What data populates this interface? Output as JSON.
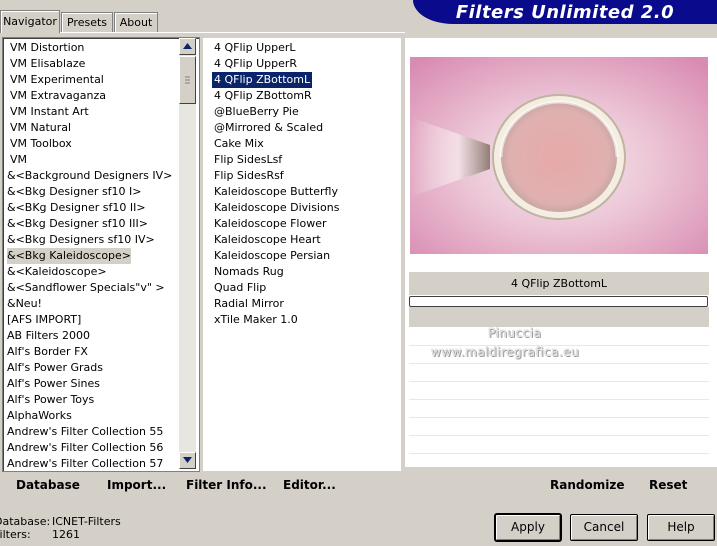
{
  "tabs": [
    "Navigator",
    "Presets",
    "About"
  ],
  "banner_title": "Filters Unlimited 2.0",
  "categories": [
    "VM Distortion",
    "VM Elisablaze",
    "VM Experimental",
    "VM Extravaganza",
    "VM Instant Art",
    "VM Natural",
    "VM Toolbox",
    "VM",
    "&<Background Designers IV>",
    "&<Bkg Designer sf10 I>",
    "&<BKg Designer sf10 II>",
    "&<Bkg Designer sf10 III>",
    "&<Bkg Designers sf10 IV>",
    "&<Bkg Kaleidoscope>",
    "&<Kaleidoscope>",
    "&<Sandflower Specials\"v\" >",
    "&Neu!",
    "[AFS IMPORT]",
    "AB Filters 2000",
    "Alf's Border FX",
    "Alf's Power Grads",
    "Alf's Power Sines",
    "Alf's Power Toys",
    "AlphaWorks",
    "Andrew's Filter Collection 55",
    "Andrew's Filter Collection 56",
    "Andrew's Filter Collection 57"
  ],
  "highlighted_category": "&<Bkg Kaleidoscope>",
  "filters": [
    "4 QFlip UpperL",
    "4 QFlip UpperR",
    "4 QFlip ZBottomL",
    "4 QFlip ZBottomR",
    "@BlueBerry Pie",
    "@Mirrored & Scaled",
    "Cake Mix",
    "Flip SidesLsf",
    "Flip SidesRsf",
    "Kaleidoscope Butterfly",
    "Kaleidoscope Divisions",
    "Kaleidoscope Flower",
    "Kaleidoscope Heart",
    "Kaleidoscope Persian",
    "Nomads Rug",
    "Quad Flip",
    "Radial Mirror",
    "xTile Maker 1.0"
  ],
  "selected_filter": "4 QFlip ZBottomL",
  "preview_name": "4 QFlip ZBottomL",
  "progress": 0,
  "watermark": [
    "Pinuccia",
    "www.maldiregrafica.eu"
  ],
  "toolbar": {
    "database": "Database",
    "import": "Import...",
    "filter_info": "Filter Info...",
    "editor": "Editor...",
    "randomize": "Randomize",
    "reset": "Reset"
  },
  "status": {
    "database_label": "Database:",
    "database_value": "ICNET-Filters",
    "filters_label": "Filters:",
    "filters_value": "1261"
  },
  "buttons": {
    "apply": "Apply",
    "cancel": "Cancel",
    "help": "Help"
  },
  "colors": {
    "selection": "#0a246a",
    "banner": "#0a0a8c",
    "face": "#d4d0c8",
    "preview_pink": "#d88cb0"
  },
  "icons": {
    "scroll_up": "triangle-up-icon",
    "scroll_down": "triangle-down-icon",
    "thumb_grip": "grip-icon"
  }
}
